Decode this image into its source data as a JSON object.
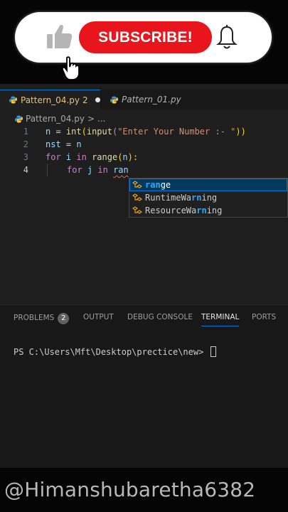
{
  "overlay": {
    "subscribe_label": "SUBSCRIBE!"
  },
  "editor": {
    "tabs": [
      {
        "name": "Pattern_04.py",
        "problems": "2",
        "modified": true,
        "active": true
      },
      {
        "name": "Pattern_01.py",
        "active": false
      }
    ],
    "breadcrumb": {
      "file": "Pattern_04.py",
      "chevron": ">",
      "more": "..."
    },
    "lines": [
      {
        "num": "1"
      },
      {
        "num": "2"
      },
      {
        "num": "3"
      },
      {
        "num": "4"
      }
    ],
    "code_tokens": {
      "l1": [
        "n",
        " = ",
        "int",
        "(",
        "input",
        "(",
        "\"Enter Your Number :- \"",
        "))"
      ],
      "l2": [
        "nst",
        " = ",
        "n"
      ],
      "l3": [
        "for",
        " ",
        "i",
        " in ",
        "range",
        "(",
        "n",
        "):"
      ],
      "l4": [
        "for",
        " ",
        "j",
        " in ",
        "ran"
      ]
    },
    "suggestions": [
      {
        "match": "ran",
        "rest": "ge",
        "selected": true
      },
      {
        "pre": "R",
        "mid": "untimeWa",
        "match": "rn",
        "post": "ing",
        "selected": false
      },
      {
        "pre": "Resource",
        "mid": "Wa",
        "match": "rn",
        "post": "ing",
        "selected": false
      }
    ]
  },
  "panel": {
    "tabs": {
      "problems": "PROBLEMS",
      "problems_count": "2",
      "output": "OUTPUT",
      "debug": "DEBUG CONSOLE",
      "terminal": "TERMINAL",
      "ports": "PORTS"
    },
    "active_tab": "TERMINAL",
    "prompt": "PS C:\\Users\\Mft\\Desktop\\prectice\\new> "
  },
  "watermark": "@Himanshubaretha6382",
  "colors": {
    "accent": "#0078d4",
    "subscribe_red": "#e8151c",
    "keyword": "#c586c0",
    "function": "#dcdcaa",
    "variable": "#9cdcfe",
    "string": "#ce9178"
  }
}
